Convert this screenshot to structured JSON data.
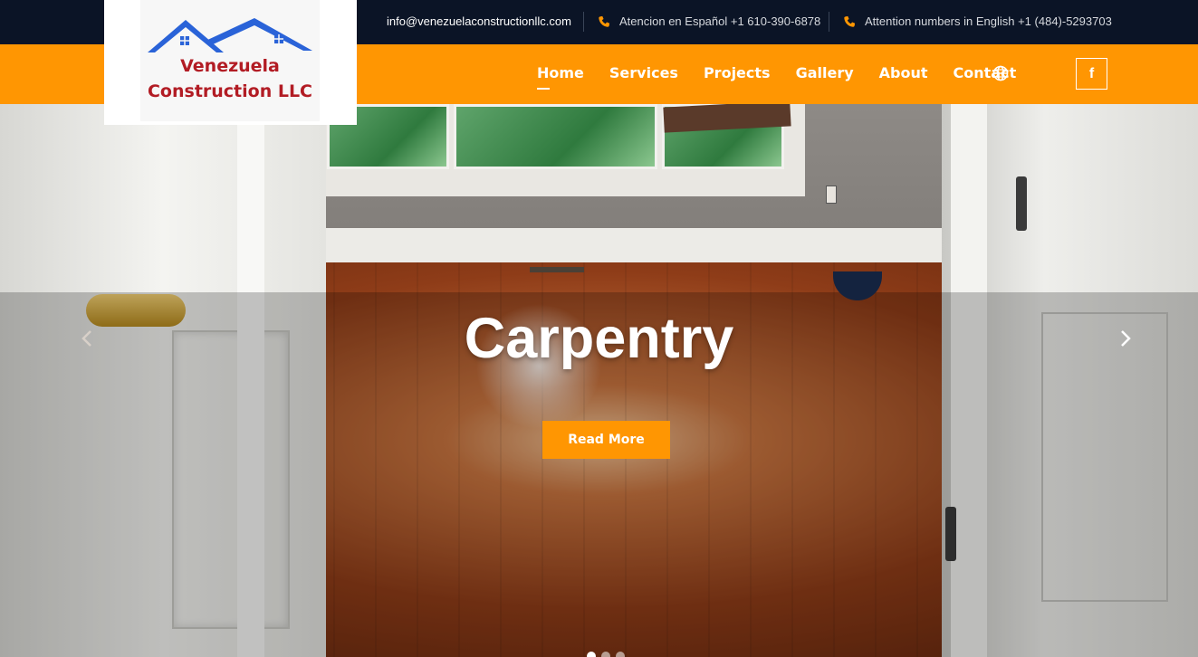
{
  "topbar": {
    "email": "info@venezuelaconstructionllc.com",
    "phone_es": "Atencion en Español +1 610-390-6878",
    "phone_en": "Attention numbers in English +1 (484)-5293703",
    "phone_icon": "phone-icon"
  },
  "logo": {
    "line1": "Venezuela",
    "line2": "Construction LLC"
  },
  "nav": {
    "items": [
      "Home",
      "Services",
      "Projects",
      "Gallery",
      "About",
      "Contact"
    ],
    "active": "Home",
    "globe_icon": "globe-icon",
    "facebook_label": "f"
  },
  "hero": {
    "title": "Carpentry",
    "button_label": "Read More",
    "prev_icon": "chevron-left-icon",
    "next_icon": "chevron-right-icon",
    "slide_count": 3,
    "active_slide": 1
  },
  "colors": {
    "accent": "#ff9602",
    "topbar": "#0b1426",
    "white": "#ffffff",
    "logo_red": "#b21c24",
    "logo_blue": "#2a63d8"
  }
}
